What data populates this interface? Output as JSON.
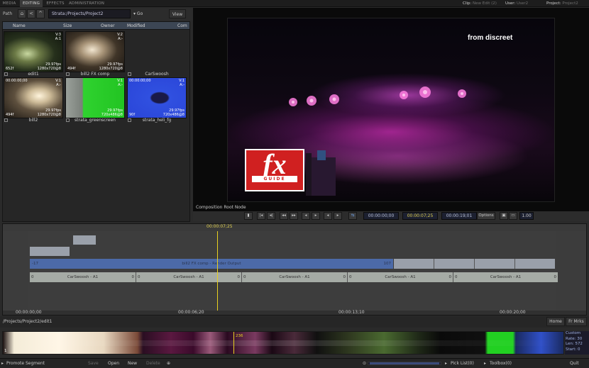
{
  "tabs": [
    "MEDIA",
    "EDITING",
    "EFFECTS",
    "ADMINISTRATION"
  ],
  "header_info": {
    "clip_label": "Clip:",
    "clip_value": "New Edit (2)",
    "user_label": "User:",
    "user_value": "User2",
    "project_label": "Project:",
    "project_value": "Project2"
  },
  "pathbar": {
    "label": "Path",
    "path": "Strata:/Projects/Project2",
    "go": "Go",
    "view": "View"
  },
  "columns": [
    "Name",
    "Size",
    "Owner",
    "Modified",
    "Com"
  ],
  "clips": [
    {
      "name": "edit1",
      "tr": "V:3\nA:1",
      "fps": "29.97fps",
      "res": "1280x720@8",
      "bl": "652f",
      "tl": ""
    },
    {
      "name": "bill2 FX comp",
      "tr": "V:2\nA:-",
      "fps": "29.97fps",
      "res": "1280x720@8",
      "bl": "494f",
      "tl": ""
    },
    {
      "name": "CarSwoosh",
      "tr": "",
      "fps": "",
      "res": "",
      "bl": "",
      "tl": ""
    },
    {
      "name": "bill2",
      "tr": "V:1\nA:-",
      "fps": "29.97fps",
      "res": "1280x720@8",
      "bl": "494f",
      "tl": "00:00:00;00"
    },
    {
      "name": "strata_greenscreen",
      "tr": "V:1\nA:-",
      "fps": "29.97fps",
      "res": "720x486@8",
      "bl": "",
      "tl": ""
    },
    {
      "name": "strata_heli_fg",
      "tr": "V:1\nA:-",
      "fps": "29.97fps",
      "res": "720x486@8",
      "bl": "90f",
      "tl": "00:00:00;00"
    }
  ],
  "viewer": {
    "overlay_text": "from discreet",
    "logo_main": "fx",
    "logo_sub": "GUIDE",
    "caption": "Composition Root Node"
  },
  "transport": {
    "tc_start": "00:00:00;00",
    "tc_current": "00:00:07;25",
    "tc_end": "00:00:19;01",
    "options": "Options",
    "zoom": "1.00"
  },
  "timeline": {
    "playhead_tc": "00:00:07;25",
    "video_clip_label": "bill2 FX comp - Render Output",
    "video_in": "-17",
    "video_out": "107",
    "audio_clips": [
      {
        "label": "CarSwoosh - A1",
        "in": "0",
        "out": "0"
      },
      {
        "label": "CarSwoosh - A1",
        "in": "0",
        "out": "0"
      },
      {
        "label": "CarSwoosh - A1",
        "in": "0",
        "out": "0"
      },
      {
        "label": "CarSwoosh - A1",
        "in": "0",
        "out": "0"
      },
      {
        "label": "CarSwoosh - A1",
        "in": "0",
        "out": "0"
      }
    ],
    "ruler": [
      "00:00:00;00",
      "00:00:06;20",
      "00:00:13;10",
      "00:00:20;00"
    ]
  },
  "status_path": "/Projects/Project2/edit1",
  "right_buttons": {
    "home": "Home",
    "fr_mrks": "Fr Mrks"
  },
  "filmstrip": {
    "marker": "236",
    "left_num": "1",
    "info": [
      "Custom",
      "Rate: 30",
      "Len: 572",
      "Start: 0"
    ]
  },
  "bottom": {
    "promote": "Promote Segment",
    "save": "Save",
    "open": "Open",
    "new": "New",
    "delete": "Delete",
    "pick_list": "Pick List(0)",
    "toolbox": "Toolbox(0)",
    "quit": "Quit"
  }
}
